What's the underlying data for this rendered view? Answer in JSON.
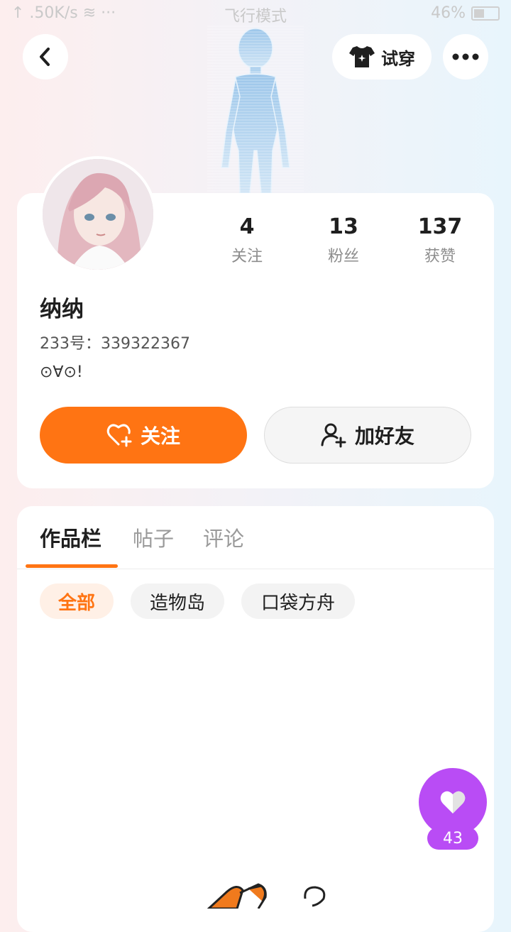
{
  "status_bar": {
    "network": "↑ .50K/s ≋ ···",
    "mode": "飞行模式",
    "battery": "46%"
  },
  "header": {
    "tryon_label": "试穿"
  },
  "profile": {
    "stats": [
      {
        "value": "4",
        "label": "关注"
      },
      {
        "value": "13",
        "label": "粉丝"
      },
      {
        "value": "137",
        "label": "获赞"
      }
    ],
    "username": "纳纳",
    "uid": "233号：339322367",
    "bio": "⊙∀⊙!",
    "follow_label": "关注",
    "add_friend_label": "加好友"
  },
  "tabs": [
    {
      "label": "作品栏"
    },
    {
      "label": "帖子"
    },
    {
      "label": "评论"
    }
  ],
  "chips": [
    {
      "label": "全部"
    },
    {
      "label": "造物岛"
    },
    {
      "label": "口袋方舟"
    }
  ],
  "like": {
    "count": "43"
  },
  "colors": {
    "accent": "#ff7413",
    "like_fab": "#b94cf5"
  }
}
